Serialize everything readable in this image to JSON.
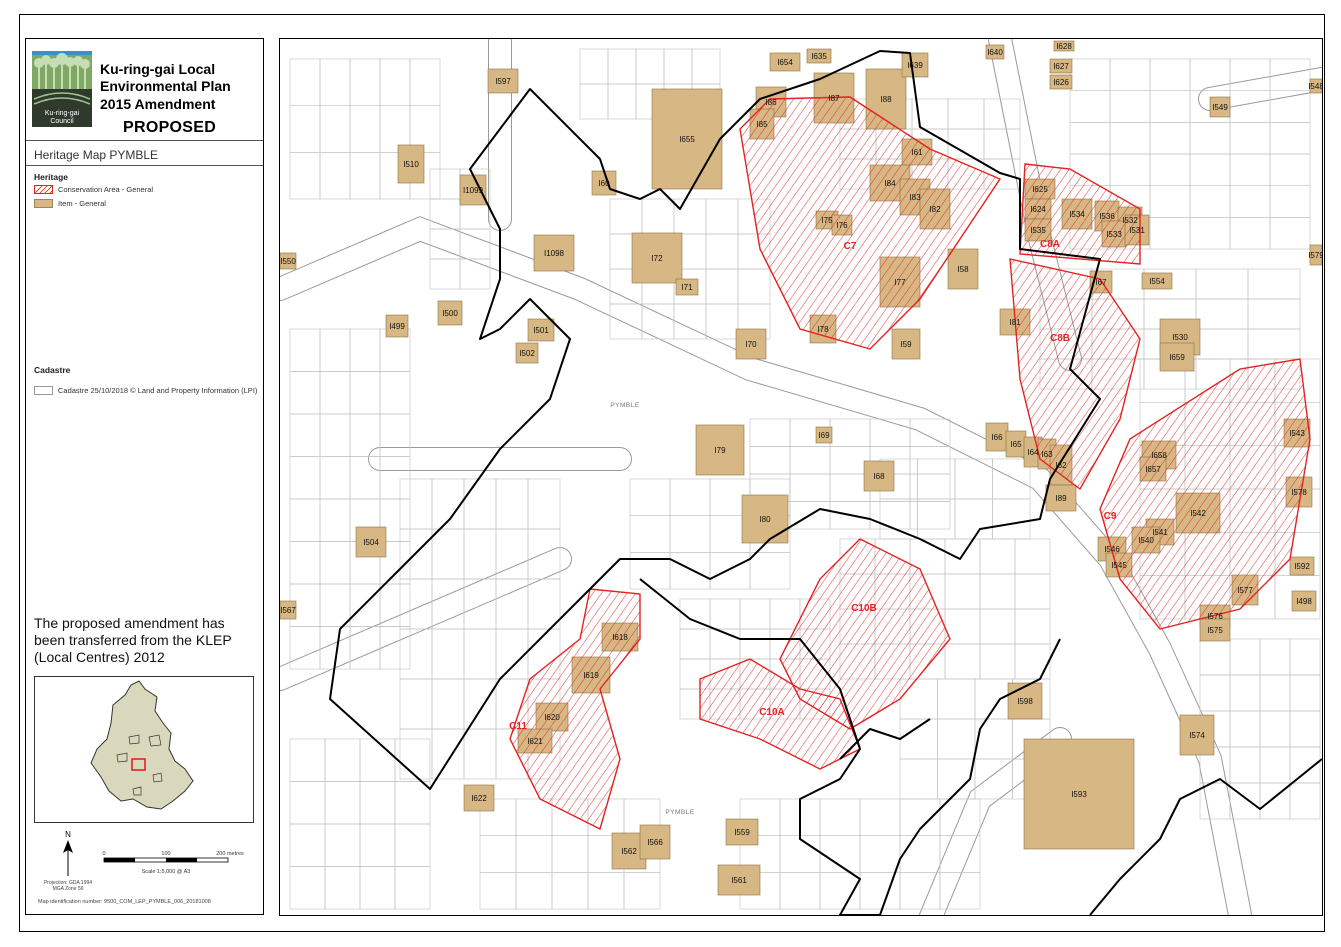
{
  "title": {
    "line1": "Ku-ring-gai Local",
    "line2": "Environmental Plan",
    "line3": "2015 Amendment",
    "status": "PROPOSED"
  },
  "logo": {
    "line1": "Ku-ring-gai",
    "line2": "Council",
    "icon": "ku-ring-gai-council-logo"
  },
  "map_title": "Heritage Map PYMBLE",
  "legend": {
    "heritage_heading": "Heritage",
    "items": [
      {
        "label": "Conservation Area - General",
        "symbol": "red-hatch",
        "color": "#e32222"
      },
      {
        "label": "Item - General",
        "symbol": "tan-fill",
        "color": "#d7b783"
      }
    ],
    "cadastre_heading": "Cadastre",
    "cadastre_item": "Cadastre 25/10/2018 © Land and Property Information (LPI)"
  },
  "note": "The proposed amendment has been transferred from the KLEP (Local Centres) 2012",
  "scale_bar": {
    "ticks": [
      "0",
      "100",
      "200 metres"
    ],
    "scale": "Scale 1:5,000 @ A3"
  },
  "north_label": "N",
  "projection": {
    "line1": "Projection: GDA 1994",
    "line2": "MGA Zone 56"
  },
  "map_id": "Map identification number: 9500_COM_LEP_PYMBLE_006_20181008",
  "colors": {
    "item_fill": "#d7b783",
    "conservation": "#e32222",
    "boundary": "#000000",
    "cadastre": "#bdbdbd"
  },
  "map": {
    "place_labels": [
      "PYMBLE",
      "PYMBLE"
    ],
    "conservation_areas": [
      "C7",
      "C8A",
      "C8B",
      "C9",
      "C10A",
      "C10B",
      "C11"
    ],
    "heritage_items": [
      "I635",
      "I654",
      "I640",
      "I628",
      "I627",
      "I626",
      "I548",
      "I549",
      "I597",
      "I655",
      "I86",
      "I87",
      "I88",
      "I639",
      "I85",
      "I510",
      "I1099",
      "I60",
      "I61",
      "I84",
      "I83",
      "I82",
      "I625",
      "I624",
      "I534",
      "I536",
      "I532",
      "I535",
      "I533",
      "I531",
      "I75",
      "I76",
      "I1098",
      "I72",
      "I71",
      "I77",
      "I58",
      "I67",
      "I554",
      "I579",
      "I550",
      "I499",
      "I500",
      "I501",
      "I502",
      "I78",
      "I70",
      "I81",
      "I530",
      "I659",
      "I59",
      "I69",
      "I66",
      "I65",
      "I64",
      "I63",
      "I62",
      "I658",
      "I543",
      "I79",
      "I68",
      "I657",
      "I89",
      "I578",
      "I80",
      "I542",
      "I541",
      "I540",
      "I504",
      "I546",
      "I545",
      "I592",
      "I577",
      "I498",
      "I567",
      "I618",
      "I576",
      "I575",
      "I619",
      "I598",
      "I620",
      "I621",
      "I574",
      "I593",
      "I622",
      "I559",
      "I562",
      "I566",
      "I561"
    ]
  }
}
